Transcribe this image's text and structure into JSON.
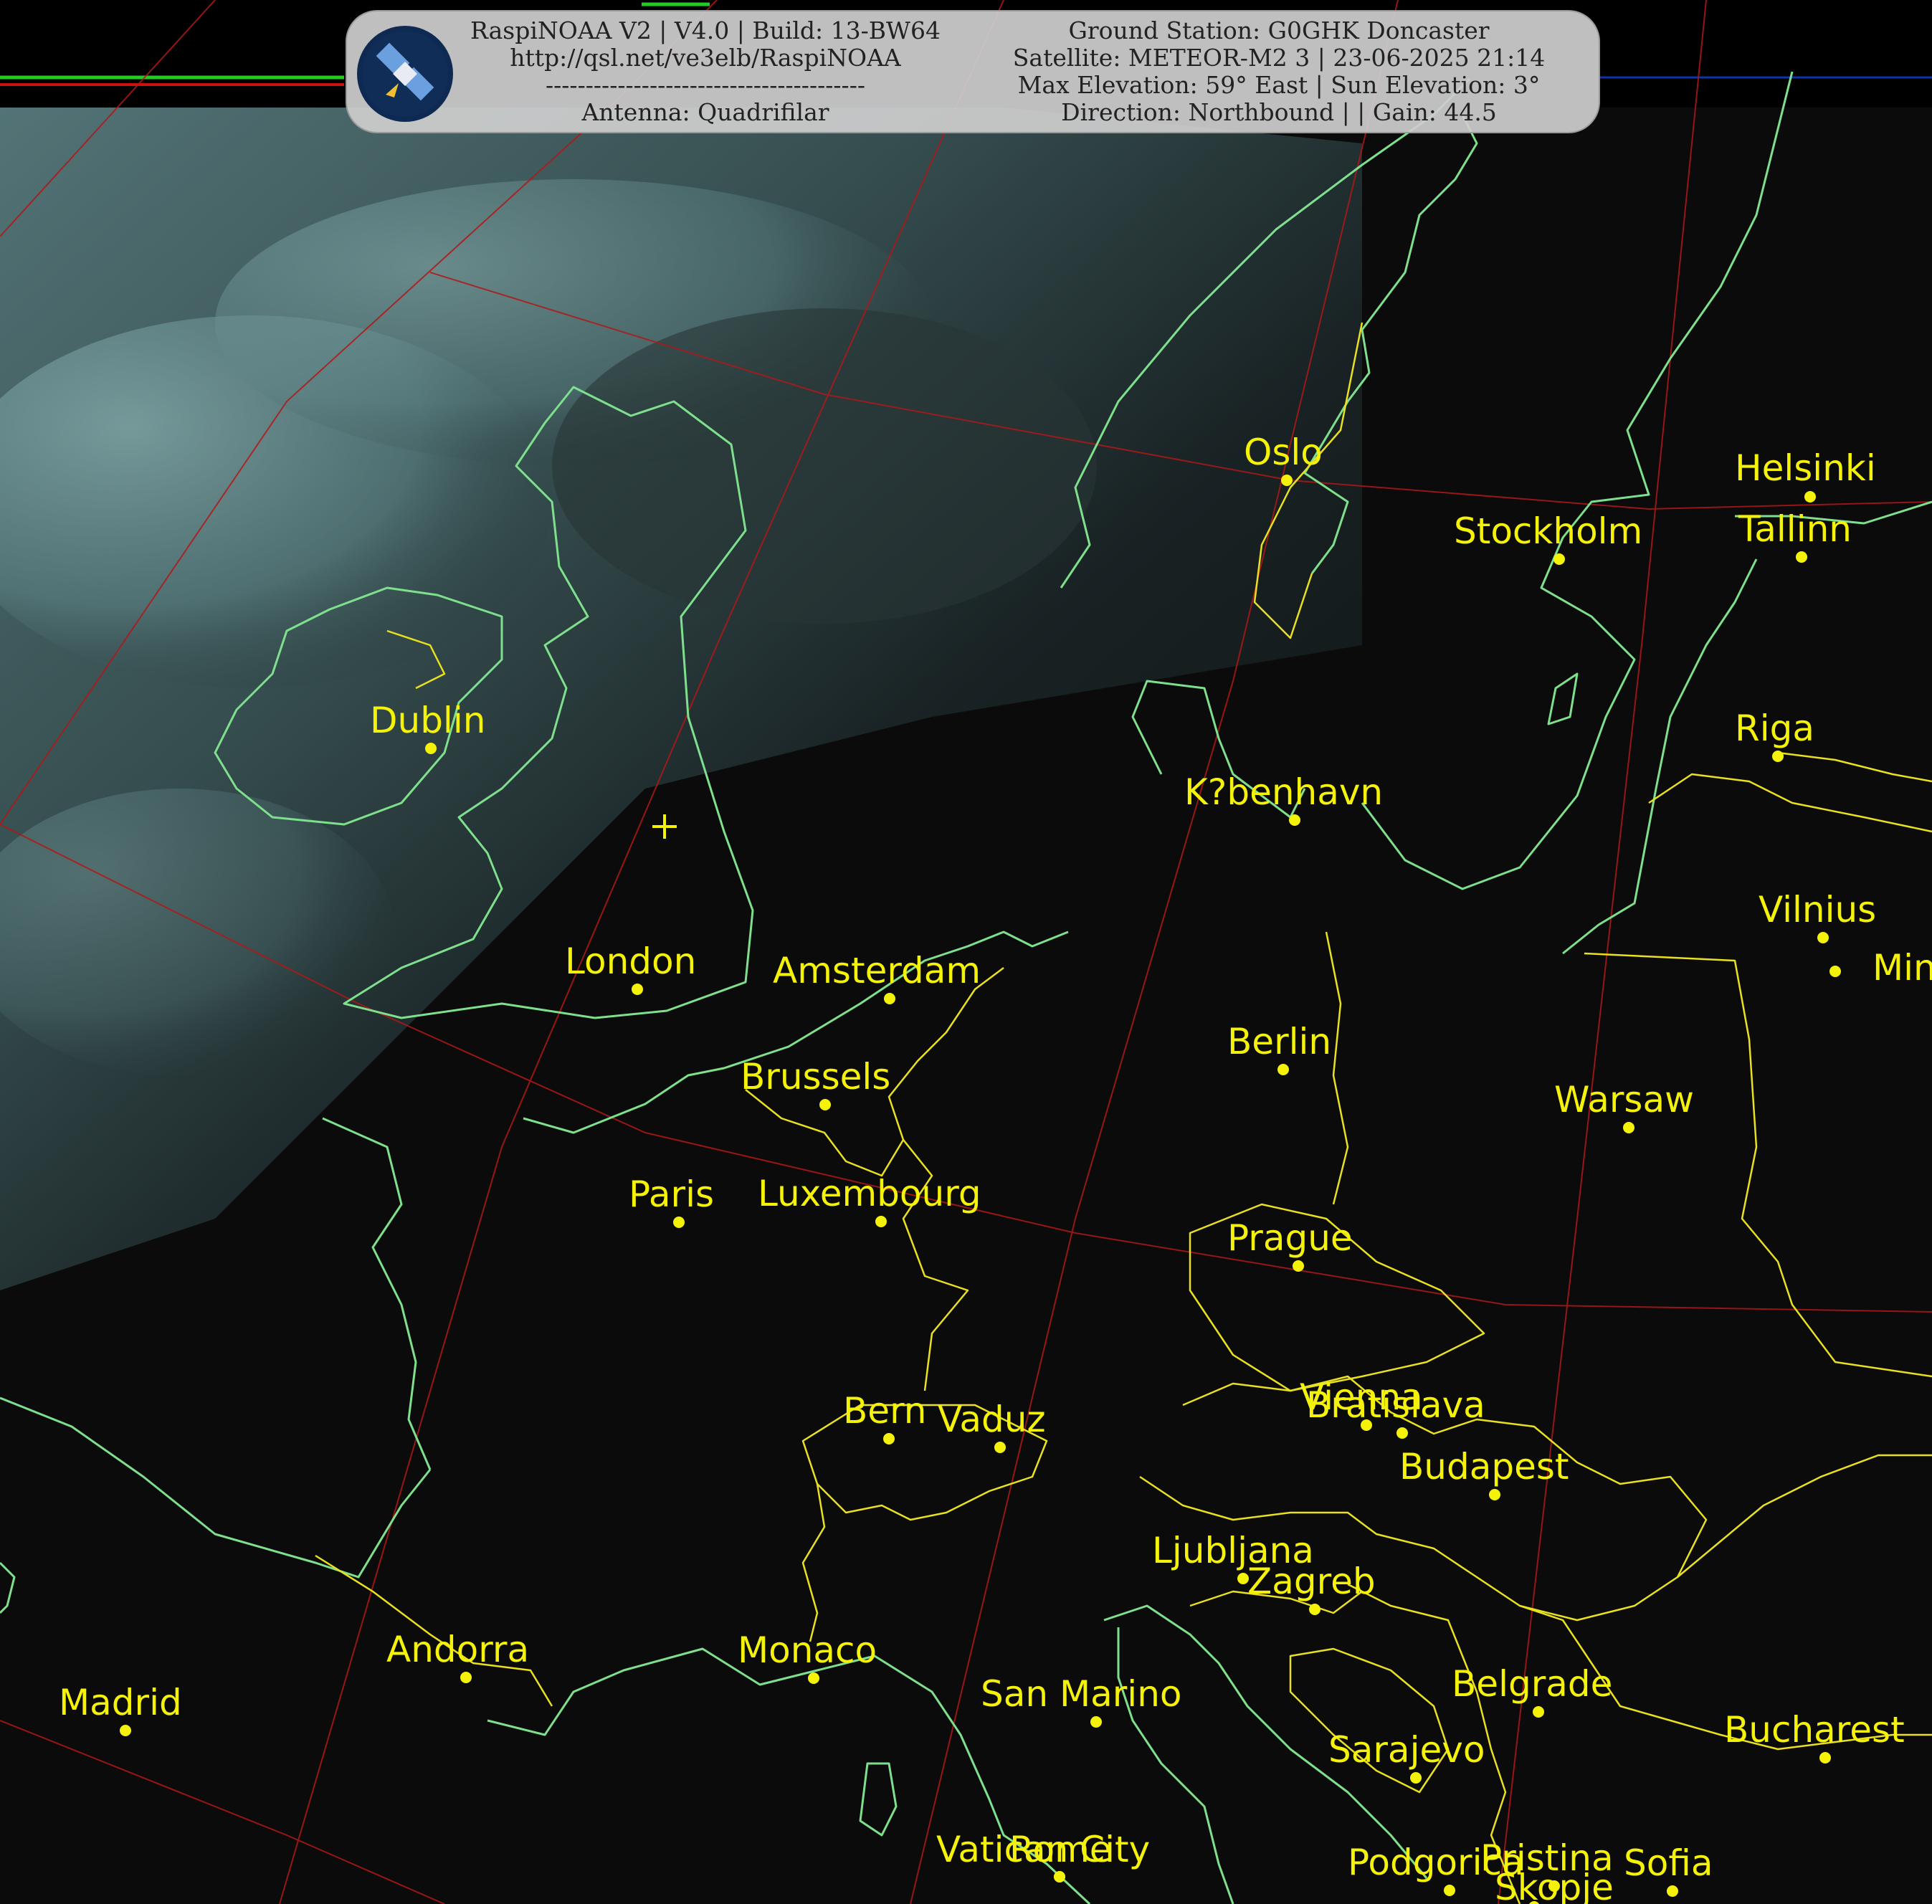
{
  "header": {
    "left_lines": [
      "RaspiNOAA V2 | V4.0 | Build: 13-BW64",
      "http://qsl.net/ve3elb/RaspiNOAA",
      "----------------------------------------",
      "Antenna: Quadrifilar"
    ],
    "right_lines": [
      "Ground Station: G0GHK Doncaster",
      "Satellite: METEOR-M2 3 | 23-06-2025 21:14",
      "Max Elevation: 59° East | Sun Elevation: 3°",
      "Direction: Northbound | | Gain: 44.5"
    ],
    "logo_icon": "satellite-icon"
  },
  "colors": {
    "coastline": "#7ee08c",
    "borders": "#e8e020",
    "graticule": "#b01818",
    "labels": "#f5f20a",
    "ocean_cloud": "#6f9a9c",
    "land": "#0b0b0b"
  },
  "cities": [
    {
      "name": "Oslo"
    },
    {
      "name": "Helsinki"
    },
    {
      "name": "Stockholm"
    },
    {
      "name": "Tallinn"
    },
    {
      "name": "Dublin"
    },
    {
      "name": "Riga"
    },
    {
      "name": "K?benhavn"
    },
    {
      "name": "Vilnius"
    },
    {
      "name": "Min"
    },
    {
      "name": "London"
    },
    {
      "name": "Amsterdam"
    },
    {
      "name": "Berlin"
    },
    {
      "name": "Brussels"
    },
    {
      "name": "Warsaw"
    },
    {
      "name": "Paris"
    },
    {
      "name": "Luxembourg"
    },
    {
      "name": "Prague"
    },
    {
      "name": "Vienna"
    },
    {
      "name": "Bratislava"
    },
    {
      "name": "Bern"
    },
    {
      "name": "Vaduz"
    },
    {
      "name": "Budapest"
    },
    {
      "name": "Ljubljana"
    },
    {
      "name": "Zagreb"
    },
    {
      "name": "Andorra"
    },
    {
      "name": "Monaco"
    },
    {
      "name": "Madrid"
    },
    {
      "name": "San Marino"
    },
    {
      "name": "Belgrade"
    },
    {
      "name": "Bucharest"
    },
    {
      "name": "Sarajevo"
    },
    {
      "name": "Vatican City"
    },
    {
      "name": "Rome"
    },
    {
      "name": "Podgorica"
    },
    {
      "name": "Pristina"
    },
    {
      "name": "Sofia"
    },
    {
      "name": "Skopje"
    }
  ],
  "ground_station_marker": "crosshair-icon"
}
